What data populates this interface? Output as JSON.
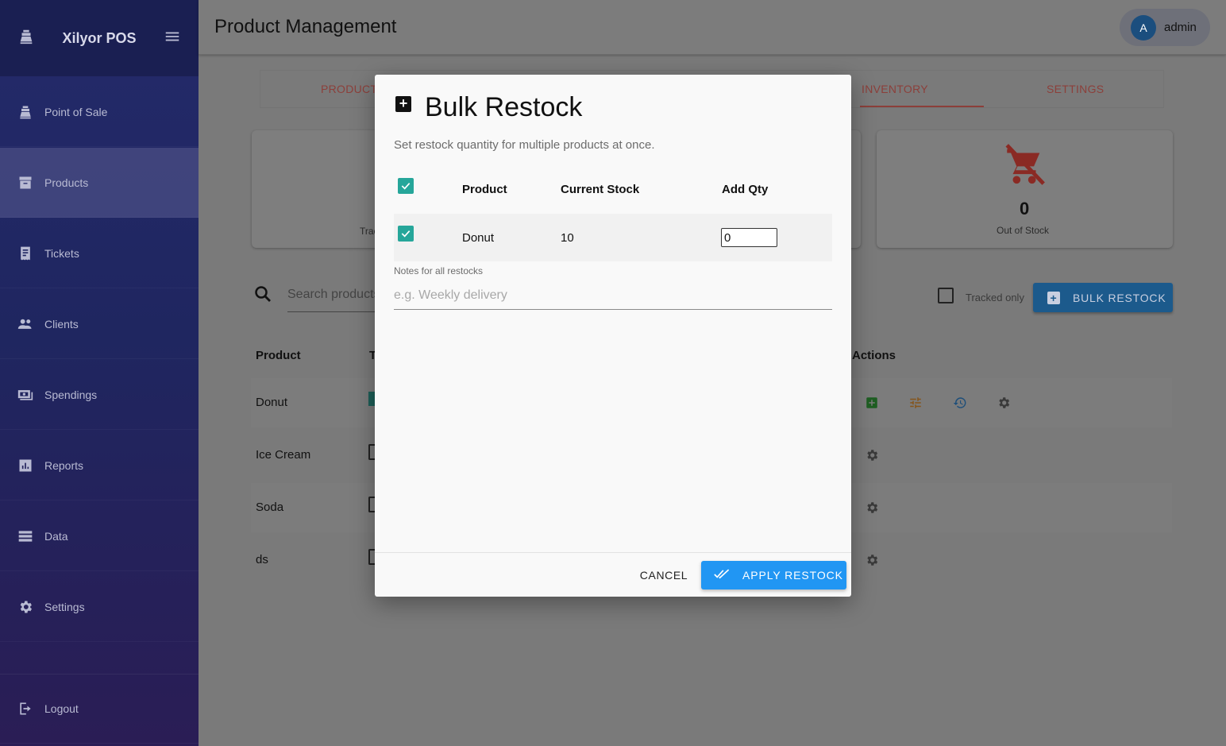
{
  "app": {
    "brand": "Xilyor POS"
  },
  "sidebar": {
    "items": [
      {
        "label": "Point of Sale",
        "icon": "cash-register-icon"
      },
      {
        "label": "Products",
        "icon": "archive-box-icon",
        "active": true
      },
      {
        "label": "Tickets",
        "icon": "receipt-icon"
      },
      {
        "label": "Clients",
        "icon": "people-icon"
      },
      {
        "label": "Spendings",
        "icon": "money-icon"
      },
      {
        "label": "Reports",
        "icon": "bar-chart-icon"
      },
      {
        "label": "Data",
        "icon": "storage-icon"
      },
      {
        "label": "Settings",
        "icon": "gear-icon"
      }
    ],
    "logout": "Logout"
  },
  "topbar": {
    "title": "Product Management",
    "user_initial": "A",
    "user_name": "admin"
  },
  "tabs": {
    "products": "PRODUCTS",
    "inventory": "INVENTORY",
    "settings": "SETTINGS"
  },
  "cards": {
    "tracked_label": "Tracked",
    "out_of_stock_value": "0",
    "out_of_stock_label": "Out of Stock"
  },
  "toolbar": {
    "search_placeholder": "Search products",
    "tracked_only": "Tracked only",
    "bulk_restock": "BULK RESTOCK"
  },
  "table": {
    "headers": {
      "product": "Product",
      "tracked": "Tracked",
      "actions": "Actions"
    },
    "rows": [
      {
        "name": "Donut",
        "tracked": true
      },
      {
        "name": "Ice Cream",
        "tracked": false
      },
      {
        "name": "Soda",
        "tracked": false
      },
      {
        "name": "ds",
        "tracked": false
      }
    ]
  },
  "modal": {
    "title": "Bulk Restock",
    "subtitle": "Set restock quantity for multiple products at once.",
    "headers": {
      "product": "Product",
      "current_stock": "Current Stock",
      "add_qty": "Add Qty"
    },
    "rows": [
      {
        "product": "Donut",
        "current_stock": "10",
        "add_qty": "0",
        "selected": true
      }
    ],
    "notes_label": "Notes for all restocks",
    "notes_placeholder": "e.g. Weekly delivery",
    "cancel": "CANCEL",
    "apply": "APPLY RESTOCK"
  },
  "colors": {
    "accent": "#2196f3",
    "check": "#26a69a",
    "tab_active": "#8c3f3a"
  }
}
